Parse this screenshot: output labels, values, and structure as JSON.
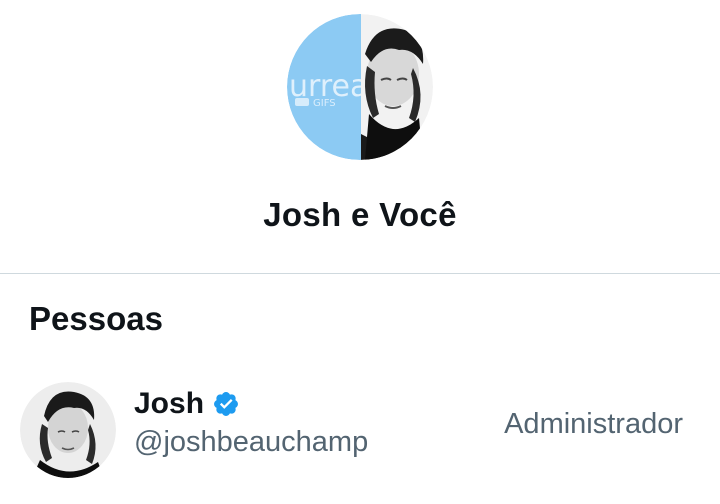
{
  "conversation": {
    "title": "Josh e Você",
    "avatar_left_text": "urrea",
    "avatar_left_subtext": "GIFS"
  },
  "people_section": {
    "title": "Pessoas",
    "members": [
      {
        "name": "Josh",
        "handle": "@joshbeauchamp",
        "role": "Administrador",
        "verified": true,
        "badge_icon": "verified-badge-icon"
      }
    ]
  },
  "colors": {
    "primary_text": "#0f1419",
    "secondary_text": "#536471",
    "divider": "#cfd9de",
    "verified_blue": "#1d9bf0",
    "avatar_light_blue": "#8ccaf3"
  }
}
